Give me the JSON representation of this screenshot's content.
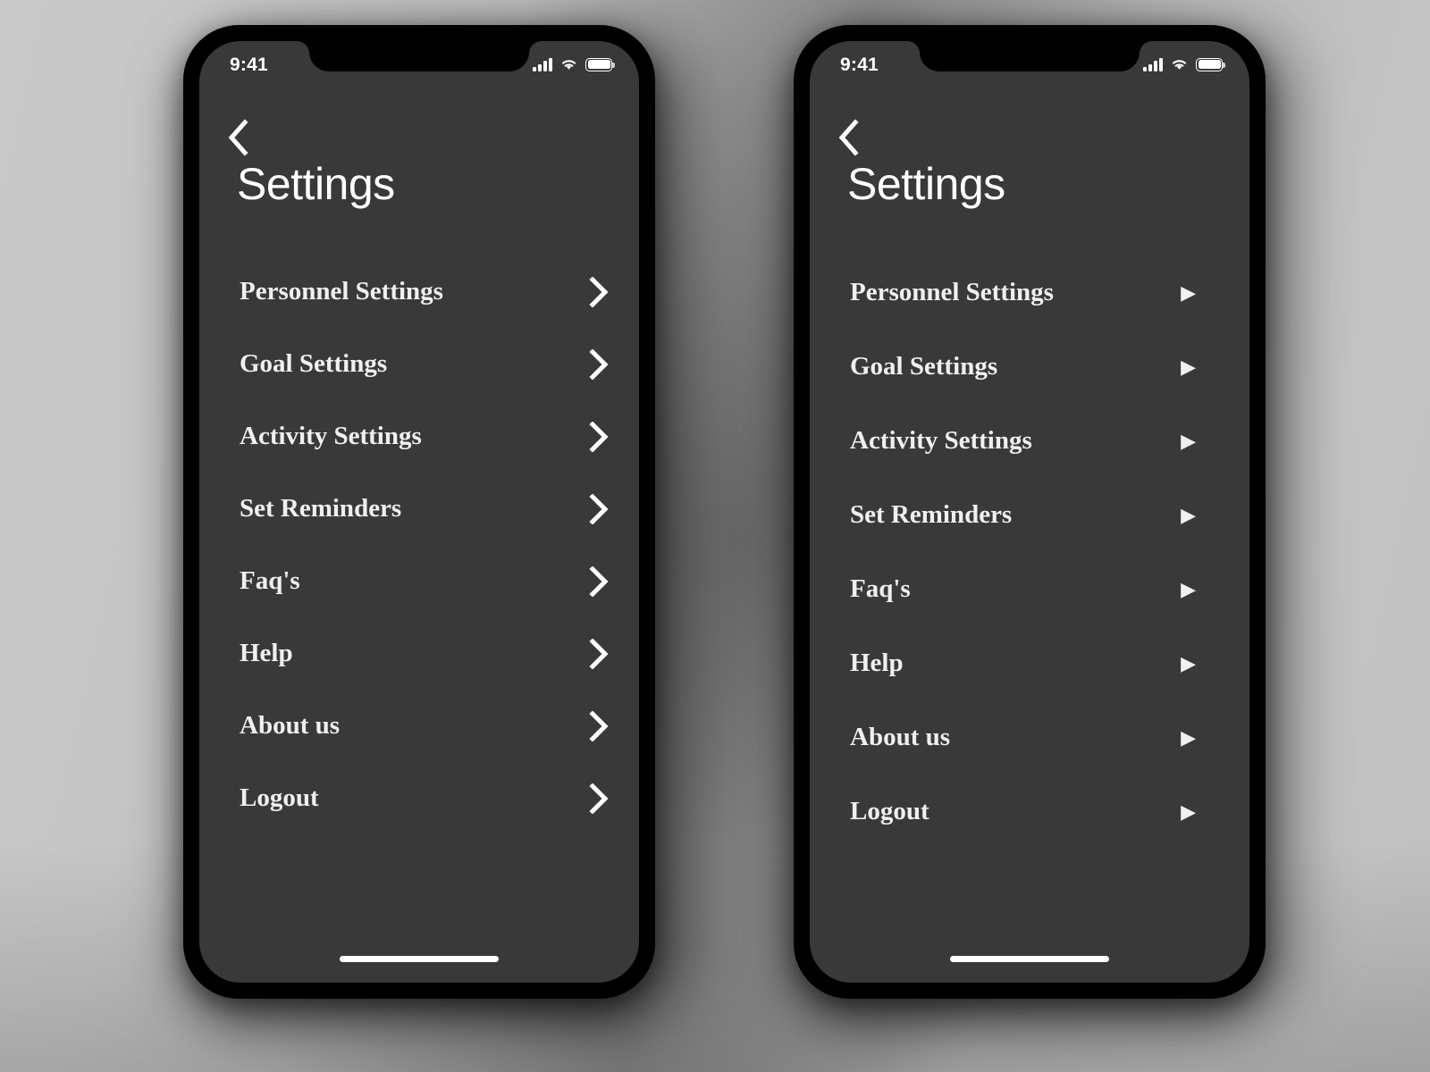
{
  "background": {
    "base_color": "#bdbdbd",
    "mid_color": "#8e8e8e"
  },
  "screens": [
    {
      "id": "left",
      "device_frame_color": "#000000",
      "screen_bg": "#393939",
      "status_bar": {
        "time": "9:41",
        "signal_icon": "signal-bars-icon",
        "wifi_icon": "wifi-icon",
        "battery_icon": "battery-icon"
      },
      "header": {
        "back_icon": "chevron-left-icon",
        "title": "Settings"
      },
      "menu": {
        "arrow_style": "chevron",
        "arrow_icon": "chevron-right-icon",
        "items": [
          {
            "label": "Personnel Settings"
          },
          {
            "label": "Goal Settings"
          },
          {
            "label": "Activity Settings"
          },
          {
            "label": "Set Reminders"
          },
          {
            "label": "Faq's"
          },
          {
            "label": "Help"
          },
          {
            "label": "About us"
          },
          {
            "label": "Logout"
          }
        ]
      },
      "home_indicator": "home-indicator"
    },
    {
      "id": "right",
      "device_frame_color": "#000000",
      "screen_bg": "#393939",
      "status_bar": {
        "time": "9:41",
        "signal_icon": "signal-bars-icon",
        "wifi_icon": "wifi-icon",
        "battery_icon": "battery-icon"
      },
      "header": {
        "back_icon": "chevron-left-icon",
        "title": "Settings"
      },
      "menu": {
        "arrow_style": "triangle",
        "arrow_icon": "triangle-right-icon",
        "arrow_glyph": "▶",
        "items": [
          {
            "label": "Personnel Settings"
          },
          {
            "label": "Goal Settings"
          },
          {
            "label": "Activity Settings"
          },
          {
            "label": "Set Reminders"
          },
          {
            "label": "Faq's"
          },
          {
            "label": "Help"
          },
          {
            "label": "About us"
          },
          {
            "label": "Logout"
          }
        ]
      },
      "home_indicator": "home-indicator"
    }
  ]
}
